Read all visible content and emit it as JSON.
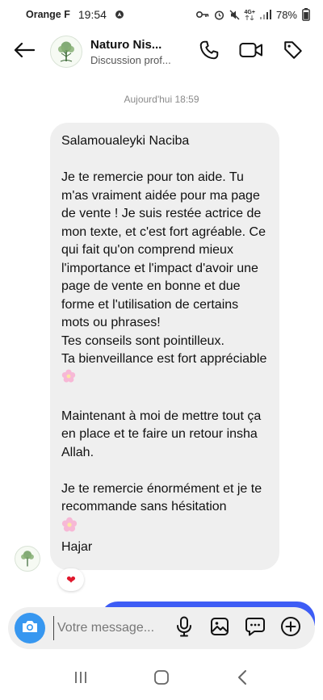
{
  "status_bar": {
    "carrier": "Orange F",
    "time": "19:54",
    "network": "4G+",
    "battery": "78%"
  },
  "header": {
    "contact_name": "Naturo Nis...",
    "contact_subtitle": "Discussion prof..."
  },
  "chat": {
    "timestamp": "Aujourd'hui 18:59",
    "message": {
      "greeting": "Salamoualeyki Naciba",
      "para1": "Je te remercie pour ton aide. Tu m'as vraiment aidée pour ma page de vente ! Je suis restée actrice de mon texte, et c'est fort agréable. Ce qui fait qu'on comprend mieux l'importance et l'impact d'avoir une page de vente en bonne et due forme et l'utilisation de certains mots ou phrases!",
      "para2": "Tes conseils sont pointilleux.",
      "para3": "Ta bienveillance est fort appréciable",
      "para4": "Maintenant à moi de mettre tout ça en place et te faire un retour insha Allah.",
      "para5": "Je te remercie énormément et je te recommande sans hésitation",
      "signature": "Hajar"
    },
    "reaction": "❤"
  },
  "composer": {
    "placeholder": "Votre message..."
  },
  "icons": {
    "back": "arrow-left-icon",
    "call": "phone-icon",
    "video": "video-camera-icon",
    "tag": "tag-icon",
    "camera": "camera-icon",
    "mic": "microphone-icon",
    "gallery": "image-icon",
    "sticker": "chat-bubble-icon",
    "add": "plus-circle-icon",
    "nav_recent": "recent-apps-icon",
    "nav_home": "home-icon",
    "nav_back": "back-chevron-icon"
  },
  "colors": {
    "accent_blue": "#3797f0",
    "bubble_gray": "#efefef",
    "heart_red": "#e0182d",
    "sent_blue": "#3d5cf5"
  }
}
